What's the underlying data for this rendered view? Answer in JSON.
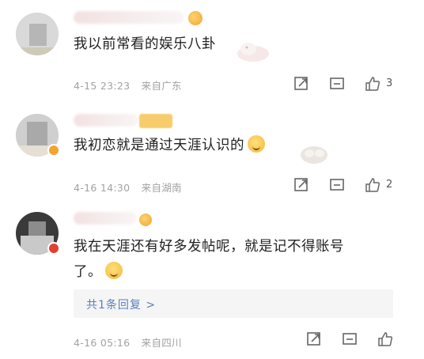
{
  "comments": [
    {
      "text": "我以前常看的娱乐八卦",
      "date": "4-15 23:23",
      "location": "来自广东",
      "likes": "3",
      "icons": [
        "share-icon",
        "comment-icon",
        "like-icon"
      ]
    },
    {
      "text": "我初恋就是通过天涯认识的",
      "date": "4-16 14:30",
      "location": "来自湖南",
      "likes": "2",
      "icons": [
        "share-icon",
        "comment-icon",
        "like-icon"
      ]
    },
    {
      "text_line1": "我在天涯还有好多发帖呢，就是记不得账号",
      "text_line2": "了。",
      "reply_link": "共1条回复 >",
      "date": "4-16 05:16",
      "location": "来自四川",
      "likes": "",
      "icons": [
        "share-icon",
        "comment-icon",
        "like-icon"
      ]
    }
  ],
  "colors": {
    "meta_gray": "#a2a2a2",
    "reply_blue": "#5a7fbf",
    "verified_orange": "#f3a431",
    "verified_red": "#e2412f"
  }
}
